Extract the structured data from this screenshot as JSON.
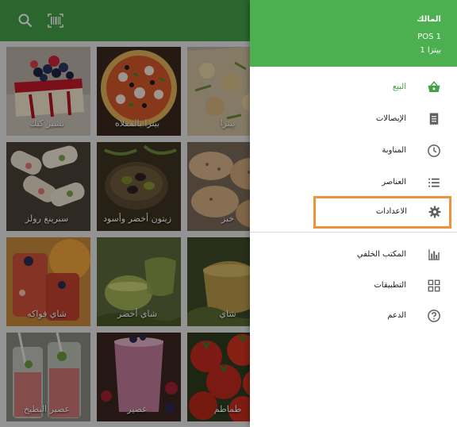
{
  "colors": {
    "primary_green": "#43a047",
    "drawer_header": "#4caf50",
    "highlight": "#f0923a"
  },
  "topbar": {
    "icons": [
      "search-icon",
      "barcode-icon"
    ]
  },
  "products": [
    {
      "name": "تشيز كيك"
    },
    {
      "name": "بيتزا بالمقلاه"
    },
    {
      "name": "بيتزا"
    },
    {
      "name": "سبرينغ رولز"
    },
    {
      "name": "زيتون أخضر وأسود"
    },
    {
      "name": "خبز"
    },
    {
      "name": "شاي فواكه"
    },
    {
      "name": "شاي أخضر"
    },
    {
      "name": "شاي"
    },
    {
      "name": "عصير البطيخ"
    },
    {
      "name": "عصير"
    },
    {
      "name": "طماطم"
    }
  ],
  "drawer": {
    "owner": "المالك",
    "pos": "POS 1",
    "store": "بيتزا 1",
    "items": [
      {
        "label": "البيع",
        "icon": "basket-icon",
        "active": true
      },
      {
        "label": "الإيصالات",
        "icon": "receipt-icon"
      },
      {
        "label": "المناوبة",
        "icon": "clock-icon"
      },
      {
        "label": "العناصر",
        "icon": "list-icon"
      },
      {
        "label": "الاعدادات",
        "icon": "gear-icon",
        "highlighted": true
      },
      {
        "label": "المكتب الخلفي",
        "icon": "bar-chart-icon"
      },
      {
        "label": "التطبيقات",
        "icon": "apps-icon"
      },
      {
        "label": "الدعم",
        "icon": "help-icon"
      }
    ]
  }
}
